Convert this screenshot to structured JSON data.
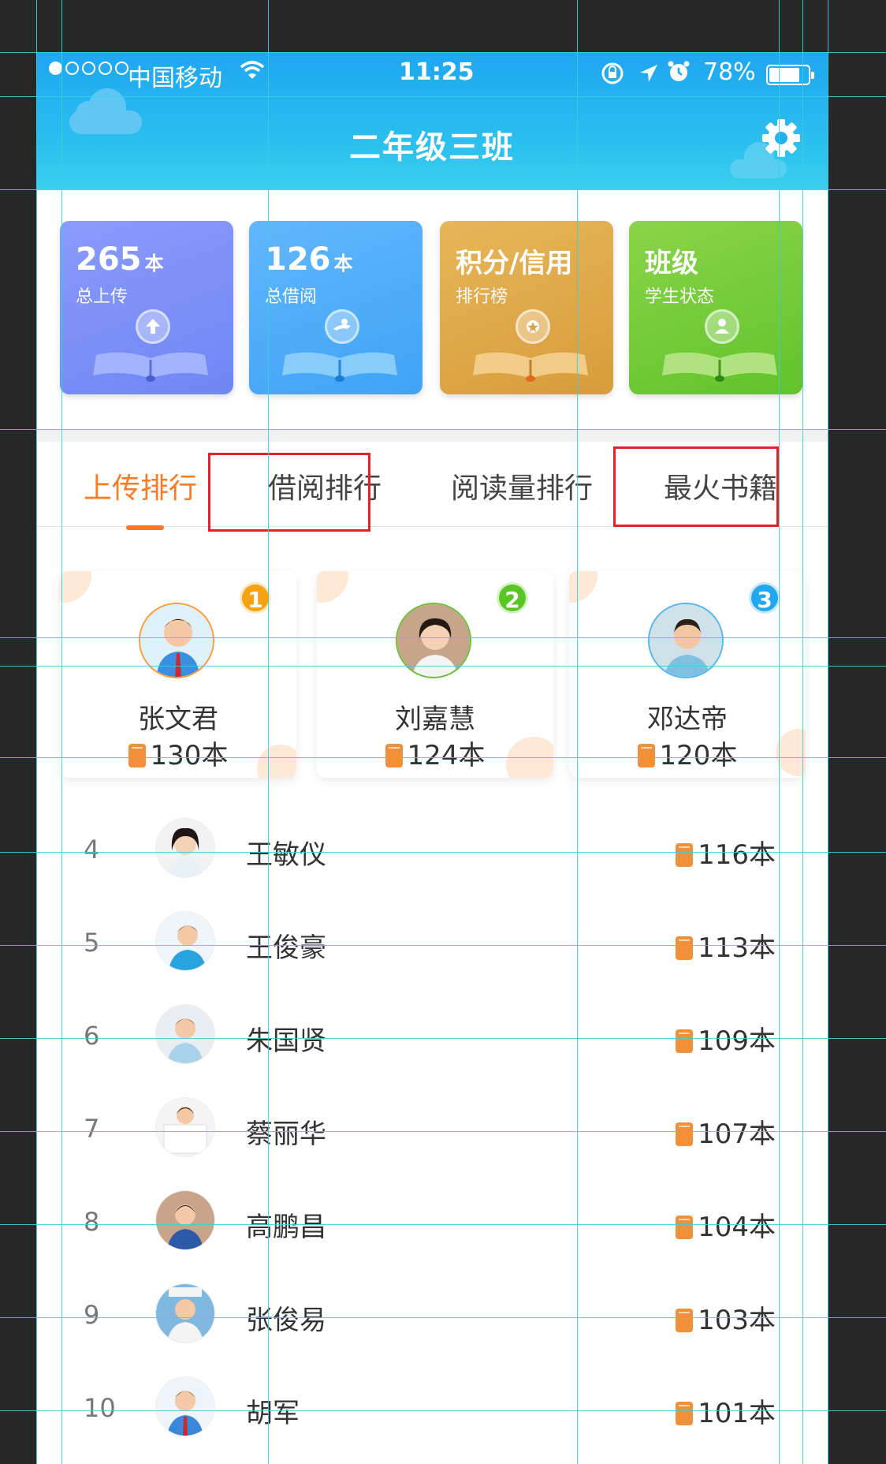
{
  "status_bar": {
    "carrier": "中国移动",
    "time": "11:25",
    "battery": "78%"
  },
  "header": {
    "title": "二年级三班",
    "settings_icon": "gear-icon"
  },
  "cards": [
    {
      "number": "265",
      "unit": "本",
      "title": "",
      "subtitle": "总上传",
      "icon": "upload-icon",
      "color": "#7a8ff7"
    },
    {
      "number": "126",
      "unit": "本",
      "title": "",
      "subtitle": "总借阅",
      "icon": "hand-icon",
      "color": "#4aa9f8"
    },
    {
      "number": "",
      "unit": "",
      "title": "积分/信用",
      "subtitle": "排行榜",
      "icon": "medal-icon",
      "color": "#dda449"
    },
    {
      "number": "",
      "unit": "",
      "title": "班级",
      "subtitle": "学生状态",
      "icon": "person-icon",
      "color": "#6fc835"
    }
  ],
  "tabs": [
    {
      "label": "上传排行",
      "active": true
    },
    {
      "label": "借阅排行",
      "active": false
    },
    {
      "label": "阅读量排行",
      "active": false
    },
    {
      "label": "最火书籍",
      "active": false
    }
  ],
  "podium": [
    {
      "rank": "1",
      "name": "张文君",
      "count": "130本"
    },
    {
      "rank": "2",
      "name": "刘嘉慧",
      "count": "124本"
    },
    {
      "rank": "3",
      "name": "邓达帝",
      "count": "120本"
    }
  ],
  "list": [
    {
      "rank": "4",
      "name": "王敏仪",
      "count": "116本"
    },
    {
      "rank": "5",
      "name": "王俊豪",
      "count": "113本"
    },
    {
      "rank": "6",
      "name": "朱国贤",
      "count": "109本"
    },
    {
      "rank": "7",
      "name": "蔡丽华",
      "count": "107本"
    },
    {
      "rank": "8",
      "name": "高鹏昌",
      "count": "104本"
    },
    {
      "rank": "9",
      "name": "张俊易",
      "count": "103本"
    },
    {
      "rank": "10",
      "name": "胡军",
      "count": "101本"
    }
  ],
  "colors": {
    "accent": "#ff7a1f",
    "header": "#1fa6f1",
    "highlight_box": "#e5202b"
  }
}
